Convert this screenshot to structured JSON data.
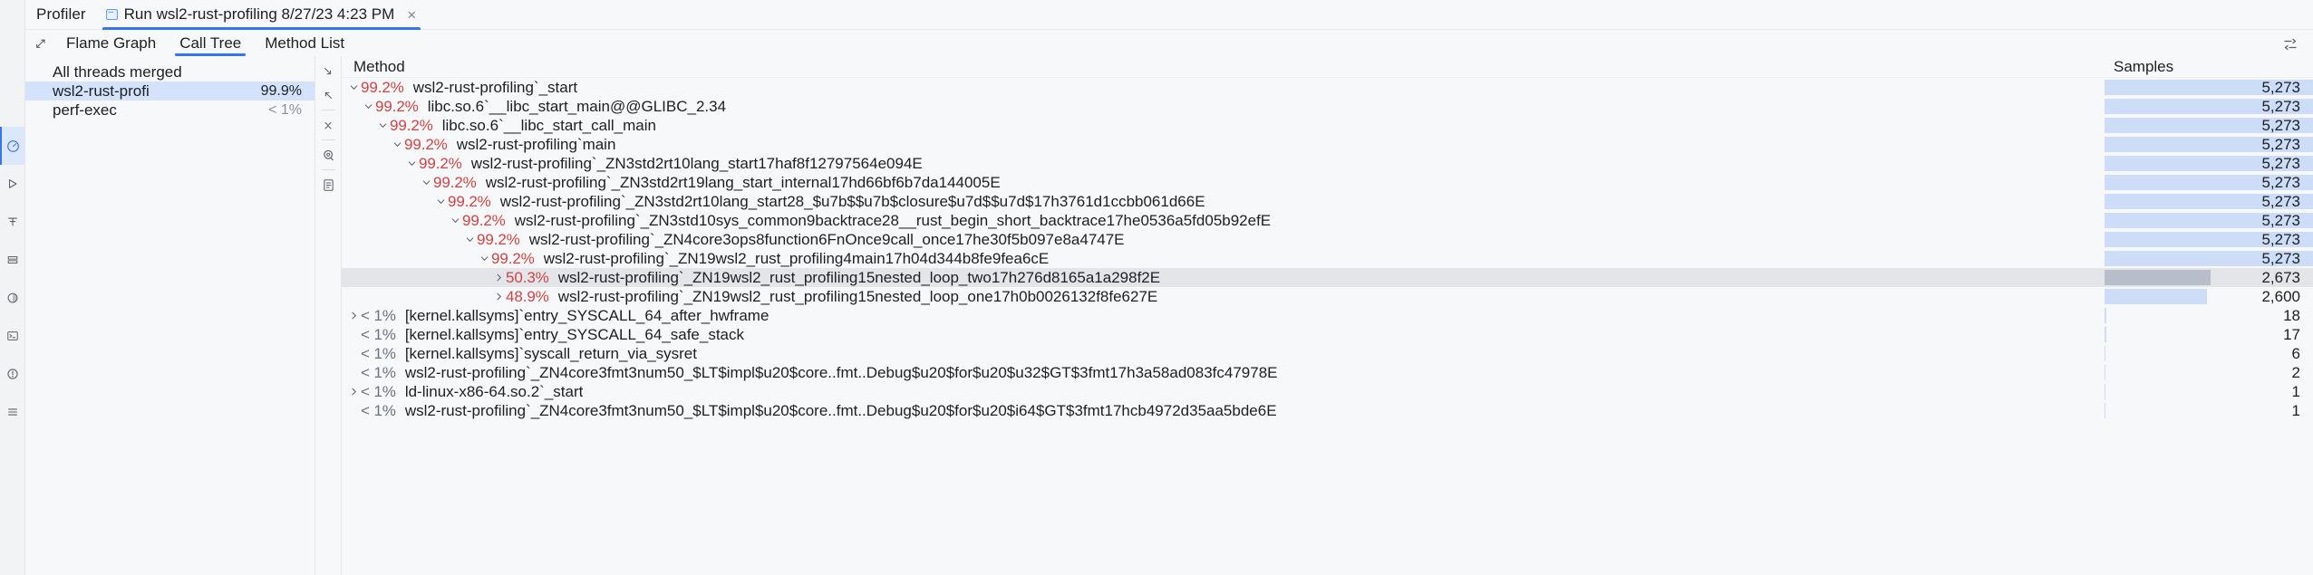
{
  "header": {
    "title": "Profiler",
    "run_tab": {
      "label": "Run wsl2-rust-profiling 8/27/23 4:23 PM",
      "close_label": "×",
      "icon": "run-config-icon"
    }
  },
  "subtabs": [
    {
      "label": "Flame Graph",
      "active": false,
      "name": "tab-flame-graph"
    },
    {
      "label": "Call Tree",
      "active": true,
      "name": "tab-call-tree"
    },
    {
      "label": "Method List",
      "active": false,
      "name": "tab-method-list"
    }
  ],
  "expand_icon": "expand-arrow-icon",
  "sort_icon": "sort-icon",
  "threads": {
    "rows": [
      {
        "name": "All threads merged",
        "pct": "",
        "selected": false
      },
      {
        "name": "wsl2-rust-profi",
        "pct": "99.9%",
        "selected": true
      },
      {
        "name": "perf-exec",
        "pct": "< 1%",
        "selected": false
      }
    ]
  },
  "midbar_icons": [
    "expand-all-icon",
    "collapse-all-icon",
    "focus-icon",
    "show-details-icon"
  ],
  "tree": {
    "columns": {
      "method": "Method",
      "samples": "Samples"
    },
    "max_samples": 5273,
    "rows": [
      {
        "indent": 0,
        "chev": "down",
        "pct": "99.2%",
        "pct_dim": false,
        "method": "wsl2-rust-profiling`_start",
        "samples": "5,273",
        "bar": 100,
        "selected": false
      },
      {
        "indent": 1,
        "chev": "down",
        "pct": "99.2%",
        "pct_dim": false,
        "method": "libc.so.6`__libc_start_main@@GLIBC_2.34",
        "samples": "5,273",
        "bar": 100,
        "selected": false
      },
      {
        "indent": 2,
        "chev": "down",
        "pct": "99.2%",
        "pct_dim": false,
        "method": "libc.so.6`__libc_start_call_main",
        "samples": "5,273",
        "bar": 100,
        "selected": false
      },
      {
        "indent": 3,
        "chev": "down",
        "pct": "99.2%",
        "pct_dim": false,
        "method": "wsl2-rust-profiling`main",
        "samples": "5,273",
        "bar": 100,
        "selected": false
      },
      {
        "indent": 4,
        "chev": "down",
        "pct": "99.2%",
        "pct_dim": false,
        "method": "wsl2-rust-profiling`_ZN3std2rt10lang_start17haf8f12797564e094E",
        "samples": "5,273",
        "bar": 100,
        "selected": false
      },
      {
        "indent": 5,
        "chev": "down",
        "pct": "99.2%",
        "pct_dim": false,
        "method": "wsl2-rust-profiling`_ZN3std2rt19lang_start_internal17hd66bf6b7da144005E",
        "samples": "5,273",
        "bar": 100,
        "selected": false
      },
      {
        "indent": 6,
        "chev": "down",
        "pct": "99.2%",
        "pct_dim": false,
        "method": "wsl2-rust-profiling`_ZN3std2rt10lang_start28_$u7b$$u7b$closure$u7d$$u7d$17h3761d1ccbb061d66E",
        "samples": "5,273",
        "bar": 100,
        "selected": false
      },
      {
        "indent": 7,
        "chev": "down",
        "pct": "99.2%",
        "pct_dim": false,
        "method": "wsl2-rust-profiling`_ZN3std10sys_common9backtrace28__rust_begin_short_backtrace17he0536a5fd05b92efE",
        "samples": "5,273",
        "bar": 100,
        "selected": false
      },
      {
        "indent": 8,
        "chev": "down",
        "pct": "99.2%",
        "pct_dim": false,
        "method": "wsl2-rust-profiling`_ZN4core3ops8function6FnOnce9call_once17he30f5b097e8a4747E",
        "samples": "5,273",
        "bar": 100,
        "selected": false
      },
      {
        "indent": 9,
        "chev": "down",
        "pct": "99.2%",
        "pct_dim": false,
        "method": "wsl2-rust-profiling`_ZN19wsl2_rust_profiling4main17h04d344b8fe9fea6cE",
        "samples": "5,273",
        "bar": 100,
        "selected": false
      },
      {
        "indent": 10,
        "chev": "right",
        "pct": "50.3%",
        "pct_dim": false,
        "method": "wsl2-rust-profiling`_ZN19wsl2_rust_profiling15nested_loop_two17h276d8165a1a298f2E",
        "samples": "2,673",
        "bar": 51,
        "selected": true
      },
      {
        "indent": 10,
        "chev": "right",
        "pct": "48.9%",
        "pct_dim": false,
        "method": "wsl2-rust-profiling`_ZN19wsl2_rust_profiling15nested_loop_one17h0b0026132f8fe627E",
        "samples": "2,600",
        "bar": 49,
        "selected": false
      },
      {
        "indent": 0,
        "chev": "right",
        "pct": "< 1%",
        "pct_dim": true,
        "method": "[kernel.kallsyms]`entry_SYSCALL_64_after_hwframe",
        "samples": "18",
        "bar": 0.7,
        "selected": false
      },
      {
        "indent": 0,
        "chev": "none",
        "pct": "< 1%",
        "pct_dim": true,
        "method": "[kernel.kallsyms]`entry_SYSCALL_64_safe_stack",
        "samples": "17",
        "bar": 0.7,
        "selected": false
      },
      {
        "indent": 0,
        "chev": "none",
        "pct": "< 1%",
        "pct_dim": true,
        "method": "[kernel.kallsyms]`syscall_return_via_sysret",
        "samples": "6",
        "bar": 0.5,
        "selected": false
      },
      {
        "indent": 0,
        "chev": "none",
        "pct": "< 1%",
        "pct_dim": true,
        "method": "wsl2-rust-profiling`_ZN4core3fmt3num50_$LT$impl$u20$core..fmt..Debug$u20$for$u20$u32$GT$3fmt17h3a58ad083fc47978E",
        "samples": "2",
        "bar": 0.4,
        "selected": false
      },
      {
        "indent": 0,
        "chev": "right",
        "pct": "< 1%",
        "pct_dim": true,
        "method": "ld-linux-x86-64.so.2`_start",
        "samples": "1",
        "bar": 0.35,
        "selected": false
      },
      {
        "indent": 0,
        "chev": "none",
        "pct": "< 1%",
        "pct_dim": true,
        "method": "wsl2-rust-profiling`_ZN4core3fmt3num50_$LT$impl$u20$core..fmt..Debug$u20$for$u20$i64$GT$3fmt17hcb4972d35aa5bde6E",
        "samples": "1",
        "bar": 0.35,
        "selected": false
      }
    ]
  },
  "rail_icons": [
    "navigator-icon",
    "run-icon",
    "structure-icon",
    "build-icon",
    "profiler-icon",
    "terminal-icon",
    "problems-icon",
    "todo-icon"
  ],
  "colors": {
    "accent": "#3574f0",
    "selection": "#d4e2fc",
    "percent_red": "#cf4444",
    "bar": "#cddcf7",
    "bar_selected": "#b7bec9",
    "background": "#f7f8fa"
  }
}
